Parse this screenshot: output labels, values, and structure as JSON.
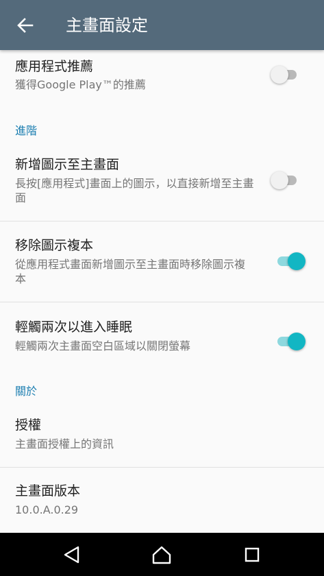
{
  "header": {
    "title": "主畫面設定",
    "back_icon": "arrow-left-icon"
  },
  "items": [
    {
      "title": "應用程式推薦",
      "subtitle": "獲得Google Play™的推薦",
      "toggle": false
    },
    {
      "title": "新增圖示至主畫面",
      "subtitle": "長按[應用程式]畫面上的圖示，以直接新增至主畫面",
      "toggle": false
    },
    {
      "title": "移除圖示複本",
      "subtitle": "從應用程式畫面新增圖示至主畫面時移除圖示複本",
      "toggle": true
    },
    {
      "title": "輕觸兩次以進入睡眠",
      "subtitle": "輕觸兩次主畫面空白區域以關閉螢幕",
      "toggle": true
    },
    {
      "title": "授權",
      "subtitle": "主畫面授權上的資訊"
    },
    {
      "title": "主畫面版本",
      "subtitle": "10.0.A.0.29"
    }
  ],
  "sections": {
    "advanced": "進階",
    "about": "關於"
  },
  "colors": {
    "appbar": "#546a7b",
    "accent": "#12b6c3",
    "section": "#1a7db0"
  },
  "navbar": {
    "back_icon": "triangle-back-icon",
    "home_icon": "home-icon",
    "recents_icon": "square-recents-icon"
  }
}
